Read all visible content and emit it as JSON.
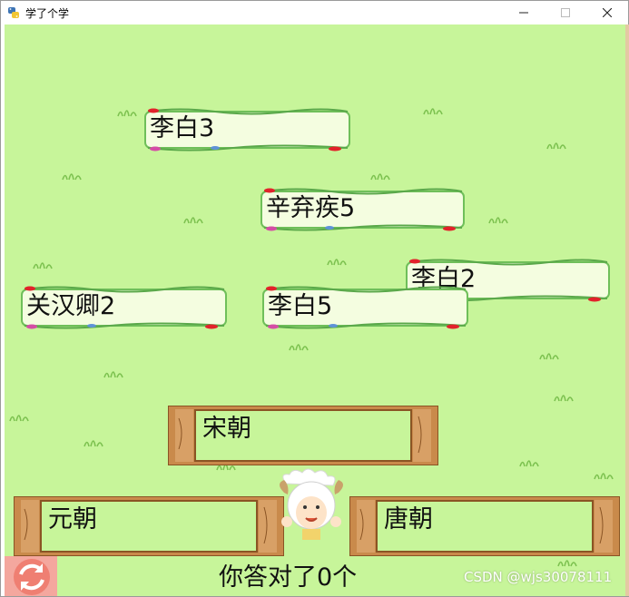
{
  "window": {
    "title": "学了个学",
    "icon": "python-icon",
    "controls": [
      "minimize",
      "maximize",
      "close"
    ]
  },
  "colors": {
    "background": "#c7f59a",
    "card_fill": "#f4fde0",
    "card_vine": "#6fbf5a",
    "wood": "#c98a4b",
    "wood_dark": "#8a5424"
  },
  "cards": [
    {
      "id": "libai3",
      "label": "李白3"
    },
    {
      "id": "xinqiji5",
      "label": "辛弃疾5"
    },
    {
      "id": "libai2",
      "label": "李白2"
    },
    {
      "id": "guanhanqing2",
      "label": "关汉卿2"
    },
    {
      "id": "libai5",
      "label": "李白5"
    }
  ],
  "bins": [
    {
      "id": "song",
      "label": "宋朝"
    },
    {
      "id": "yuan",
      "label": "元朝"
    },
    {
      "id": "tang",
      "label": "唐朝"
    }
  ],
  "score_text": "你答对了0个",
  "watermark": "CSDN @wjs30078111",
  "icons": {
    "sheep": "pleasant-goat-icon",
    "refresh": "refresh-icon"
  }
}
